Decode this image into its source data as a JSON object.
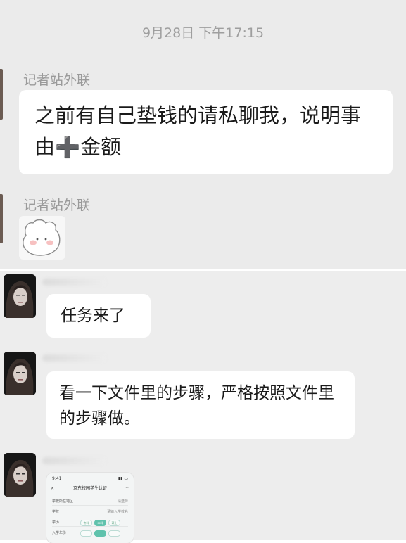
{
  "top_screenshot": {
    "timestamp": "9月28日 下午17:15",
    "messages": [
      {
        "sender": "记者站外联",
        "text": "之前有自己垫钱的请私聊我，说明事由➕金额"
      },
      {
        "sender": "记者站外联",
        "sticker": "cute-white-bunny-sticker"
      }
    ]
  },
  "bottom_screenshot": {
    "messages": [
      {
        "text": "任务来了"
      },
      {
        "text": "看一下文件里的步骤，严格按照文件里的步骤做。"
      },
      {
        "attachment": "phone-screenshot-image"
      }
    ],
    "attachment_preview": {
      "status_time": "9:41",
      "title": "京东校园学生认证",
      "rows": [
        {
          "label": "学校所在地区",
          "value": "请选择"
        },
        {
          "label": "学校",
          "value": "请输入学校名"
        },
        {
          "label": "学历",
          "value": ""
        },
        {
          "label": "入学年份",
          "value": ""
        }
      ],
      "degree_options": [
        "专科",
        "本科",
        "硕士"
      ],
      "degree_selected_index": 1
    }
  },
  "colors": {
    "background": "#ebebeb",
    "bubble": "#ffffff",
    "meta_text": "#9e9e9e",
    "message_text": "#1a1a1a",
    "accent_chip": "#5fc2ac"
  }
}
